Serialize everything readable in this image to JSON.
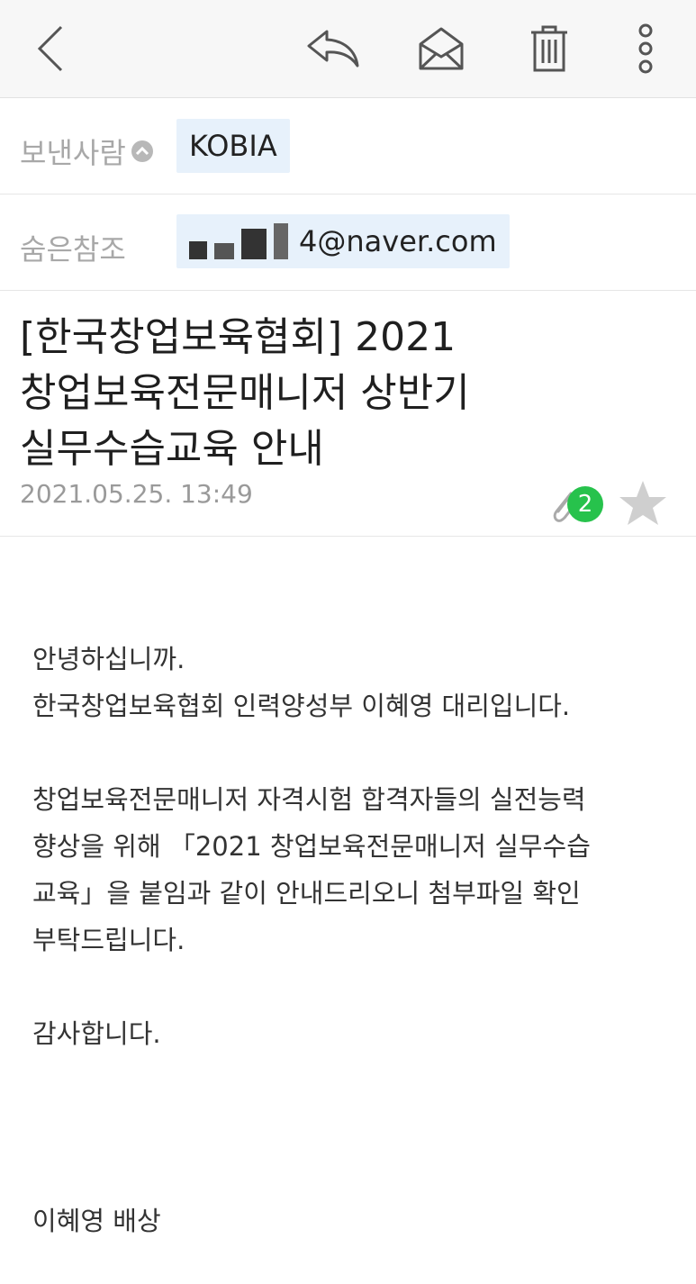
{
  "toolbar": {
    "icons": [
      "back-icon",
      "reply-icon",
      "mark-read-icon",
      "trash-icon",
      "more-icon"
    ]
  },
  "header": {
    "sender_label": "보낸사람",
    "sender_name": "KOBIA",
    "bcc_label": "숨은참조",
    "bcc_email_visible": "4@naver.com"
  },
  "message": {
    "subject_lines": [
      "[한국창업보육협회] 2021",
      "창업보육전문매니저 상반기",
      "실무수습교육 안내"
    ],
    "date": "2021.05.25. 13:49",
    "attachment_count": "2",
    "starred": false,
    "body": {
      "greeting": "안녕하십니까.",
      "intro": "한국창업보육협회 인력양성부 이혜영 대리입니다.",
      "para_lines": [
        "창업보육전문매니저 자격시험 합격자들의 실전능력",
        "향상을 위해 「2021 창업보육전문매니저 실무수습",
        "교육」을 붙임과 같이 안내드리오니 첨부파일 확인",
        "부탁드립니다."
      ],
      "thanks": "감사합니다.",
      "signature": "이혜영 배상"
    }
  },
  "colors": {
    "chip_bg": "#e7f1fb",
    "badge_green": "#27c24c",
    "label_gray": "#a8a8a8"
  }
}
